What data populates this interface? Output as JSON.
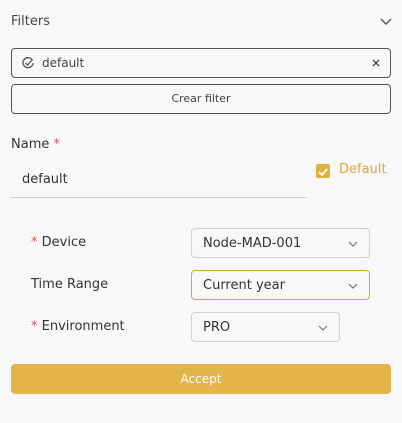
{
  "filters": {
    "title": "Filters",
    "chip_label": "default",
    "clear_filter_label": "Crear filter"
  },
  "form": {
    "name_label": "Name",
    "required_mark": "*",
    "name_value": "default",
    "default_label": "Default",
    "default_checked": true,
    "fields": [
      {
        "label": "Device",
        "required": true,
        "value": "Node-MAD-001"
      },
      {
        "label": "Time Range",
        "required": false,
        "value": "Current year"
      },
      {
        "label": "Environment",
        "required": true,
        "value": "PRO"
      }
    ],
    "accept_label": "Accept"
  },
  "colors": {
    "accent": "#e3b448",
    "required": "#d9534f",
    "background": "#f8f8f8"
  }
}
